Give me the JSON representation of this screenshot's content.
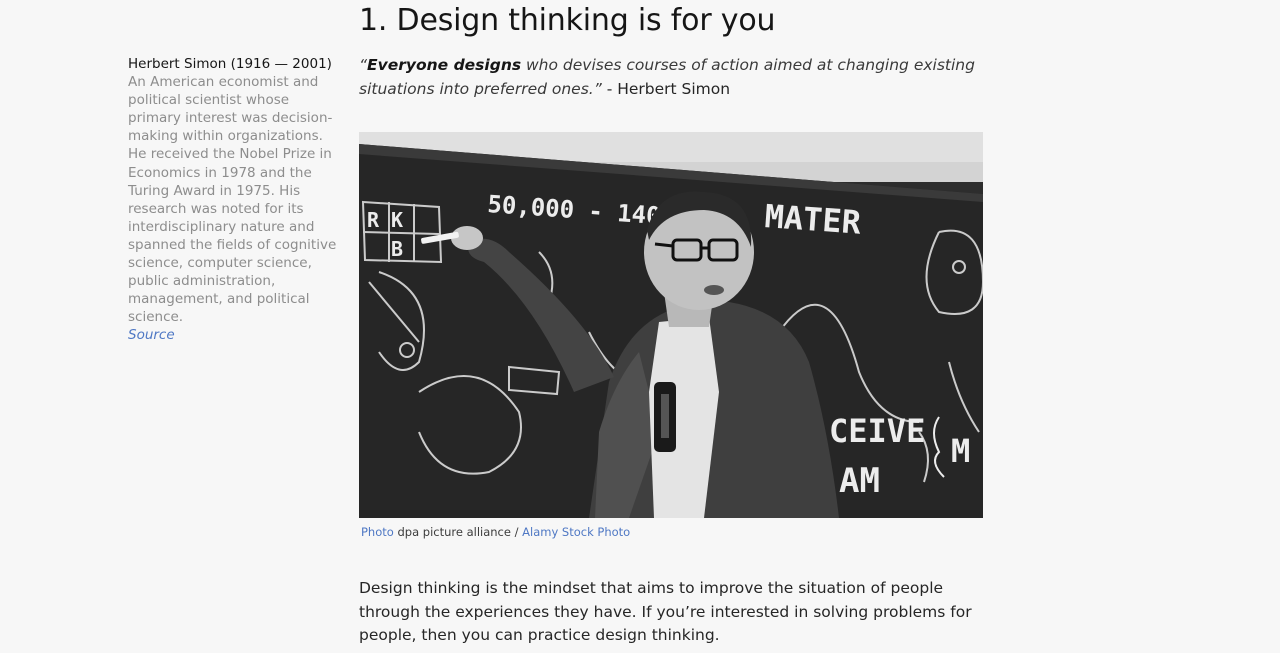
{
  "sidebar": {
    "name": "Herbert Simon (1916 — 2001)",
    "bio": "An American economist and political scientist whose primary interest was decision-making within organizations. He received the Nobel Prize in Economics in 1978 and the Turing Award in 1975. His research was noted for its interdisciplinary nature and spanned the fields of cognitive science, computer science, public administration, management, and political science.",
    "source_label": "Source"
  },
  "main": {
    "title": "1. Design thinking is for you",
    "quote": {
      "open_mark": "“",
      "bold": "Everyone designs",
      "rest": " who devises courses of action aimed at changing existing situations into preferred ones.”",
      "attribution": " - Herbert Simon"
    },
    "photo": {
      "alt": "Herbert Simon lecturing at a chalkboard",
      "chalk_texts": [
        "50,000 - 140,000",
        "MATER",
        "CEIVE",
        "AM",
        "M",
        "R",
        "K",
        "B"
      ]
    },
    "caption": {
      "photo_label": "Photo",
      "credit": " dpa picture alliance / ",
      "agency": "Alamy Stock Photo"
    },
    "body": "Design thinking is the mindset that aims to improve the situation of people through the experiences they have. If you’re interested in solving problems for people, then you can practice design thinking."
  },
  "colors": {
    "background": "#f7f7f7",
    "link": "#4f78c4",
    "muted_text": "#8d8d8d",
    "text": "#262626"
  }
}
